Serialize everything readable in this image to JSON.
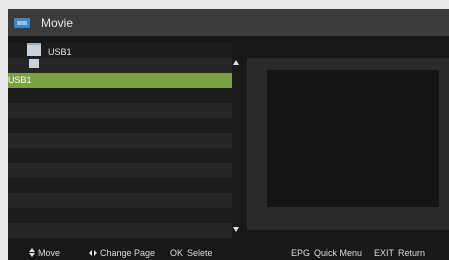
{
  "window": {
    "title": "Movie",
    "icon": "movie-icon"
  },
  "browser": {
    "current_folder": "USB1",
    "items": [
      {
        "label": "",
        "icon": "file-icon"
      },
      {
        "label": "USB1",
        "selected": true
      },
      {
        "label": ""
      },
      {
        "label": ""
      },
      {
        "label": ""
      },
      {
        "label": ""
      },
      {
        "label": ""
      },
      {
        "label": ""
      },
      {
        "label": ""
      },
      {
        "label": ""
      },
      {
        "label": ""
      }
    ]
  },
  "footer": {
    "move": "Move",
    "change_page": "Change Page",
    "ok_key": "OK",
    "ok_action": "Selete",
    "epg_key": "EPG",
    "epg_action": "Quick Menu",
    "exit_key": "EXIT",
    "exit_action": "Return"
  },
  "colors": {
    "selected_row": "#7aa142",
    "title_bar": "#3b3b3b",
    "background": "#181818"
  }
}
